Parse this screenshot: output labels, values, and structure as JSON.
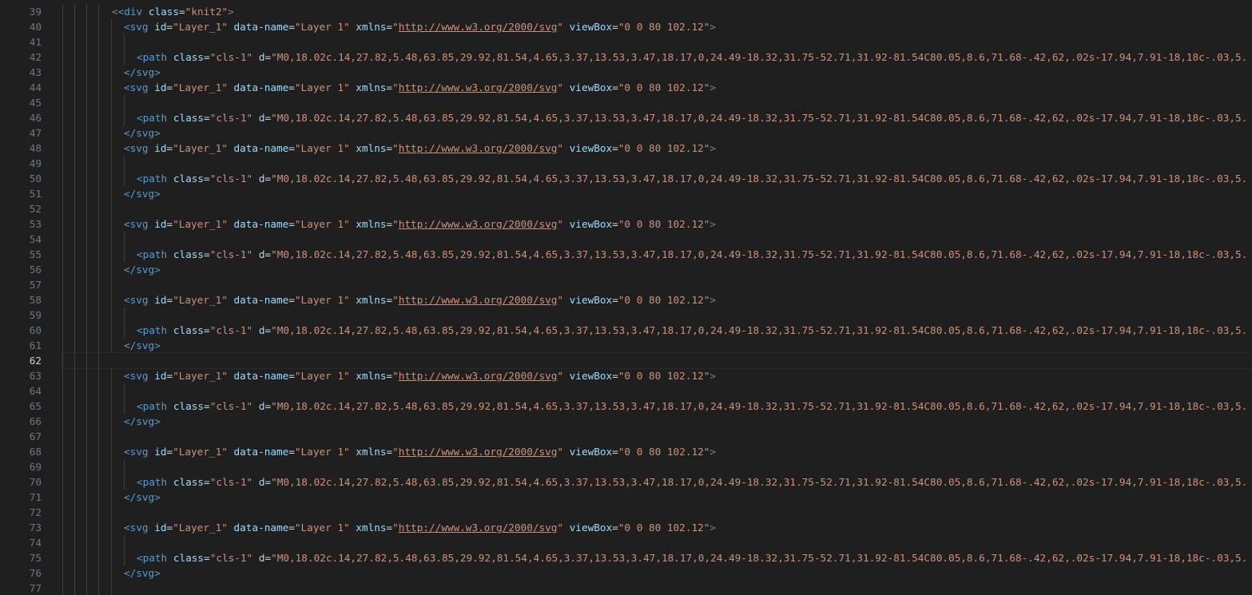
{
  "editor": {
    "line_numbers": [
      "39",
      "40",
      "41",
      "42",
      "43",
      "44",
      "45",
      "46",
      "47",
      "48",
      "49",
      "50",
      "51",
      "52",
      "53",
      "54",
      "55",
      "56",
      "57",
      "58",
      "59",
      "60",
      "61",
      "62",
      "63",
      "64",
      "65",
      "66",
      "67",
      "68",
      "69",
      "70",
      "71",
      "72",
      "73",
      "74",
      "75",
      "76",
      "77"
    ],
    "active_line": "62"
  },
  "code": {
    "div_open": "<div",
    "div_class_attr": "class",
    "div_class_value": "\"knit2\"",
    "svg_open": "<svg",
    "svg_id_attr": "id",
    "svg_id_value": "\"Layer_1\"",
    "svg_dataname_attr": "data-name",
    "svg_dataname_value": "\"Layer 1\"",
    "svg_xmlns_attr": "xmlns",
    "svg_xmlns_value": "http://www.w3.org/2000/svg",
    "svg_viewbox_attr": "viewBox",
    "svg_viewbox_value": "\"0 0 80 102.12\"",
    "path_open": "<path",
    "path_class_attr": "class",
    "path_class_value": "\"cls-1\"",
    "path_d_attr": "d",
    "path_d_value": "\"M0,18.02c.14,27.82,5.48,63.85,29.92,81.54,4.65,3.37,13.53,3.47,18.17,0,24.49-18.32,31.75-52.71,31.92-81.54C80.05,8.6,71.68-.42,62,.02s-17.94,7.91-18,18c-.03,5.",
    "svg_close": "</svg>"
  },
  "colors": {
    "background": "#1f1f1f",
    "line_number": "#6e7681",
    "tag_name": "#569cd6",
    "attr_name": "#9cdcfe",
    "attr_value": "#ce9178"
  }
}
